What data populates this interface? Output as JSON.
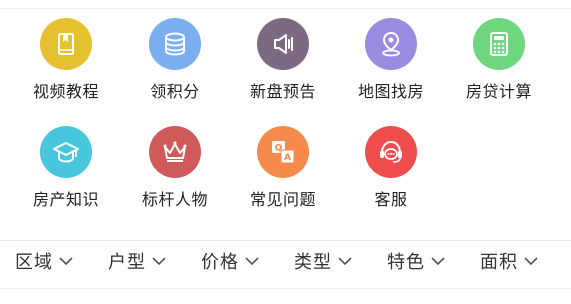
{
  "menu": {
    "items": [
      {
        "label": "视频教程",
        "icon": "book-icon",
        "color": "#E5C02F"
      },
      {
        "label": "领积分",
        "icon": "coins-stack-icon",
        "color": "#7AAFF0"
      },
      {
        "label": "新盘预告",
        "icon": "speaker-icon",
        "color": "#7C6A83"
      },
      {
        "label": "地图找房",
        "icon": "map-pin-icon",
        "color": "#9A8BE0"
      },
      {
        "label": "房贷计算",
        "icon": "calculator-icon",
        "color": "#6FD57F"
      },
      {
        "label": "房产知识",
        "icon": "graduation-cap-icon",
        "color": "#47C6DD"
      },
      {
        "label": "标杆人物",
        "icon": "crown-icon",
        "color": "#D05A5A"
      },
      {
        "label": "常见问题",
        "icon": "qa-icon",
        "color": "#F58A4B"
      },
      {
        "label": "客服",
        "icon": "headset-chat-icon",
        "color": "#F04E4E"
      }
    ]
  },
  "filters": {
    "items": [
      {
        "label": "区域"
      },
      {
        "label": "户型"
      },
      {
        "label": "价格"
      },
      {
        "label": "类型"
      },
      {
        "label": "特色"
      },
      {
        "label": "面积"
      }
    ],
    "chevron_icon": "chevron-down-icon"
  }
}
